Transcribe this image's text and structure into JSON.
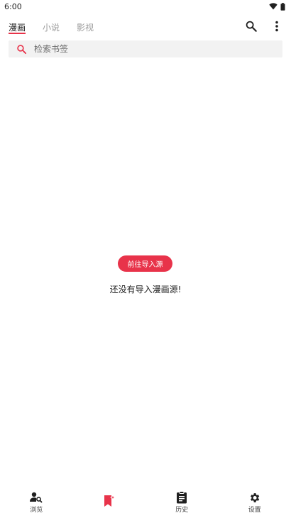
{
  "status_bar": {
    "time": "6:00"
  },
  "tabs": [
    {
      "label": "漫画",
      "active": true
    },
    {
      "label": "小说",
      "active": false
    },
    {
      "label": "影视",
      "active": false
    }
  ],
  "search": {
    "placeholder": "检索书签",
    "value": ""
  },
  "empty_state": {
    "button_label": "前往导入源",
    "message": "还没有导入漫画源!"
  },
  "bottom_nav": [
    {
      "label": "浏览",
      "icon": "person-search-icon",
      "active": false
    },
    {
      "label": "",
      "icon": "bookmark-star-icon",
      "active": true
    },
    {
      "label": "历史",
      "icon": "clipboard-icon",
      "active": false
    },
    {
      "label": "设置",
      "icon": "gear-icon",
      "active": false
    }
  ],
  "colors": {
    "accent": "#e8334a",
    "text": "#222222",
    "muted": "#9a9a9a",
    "search_bg": "#f2f2f2"
  }
}
